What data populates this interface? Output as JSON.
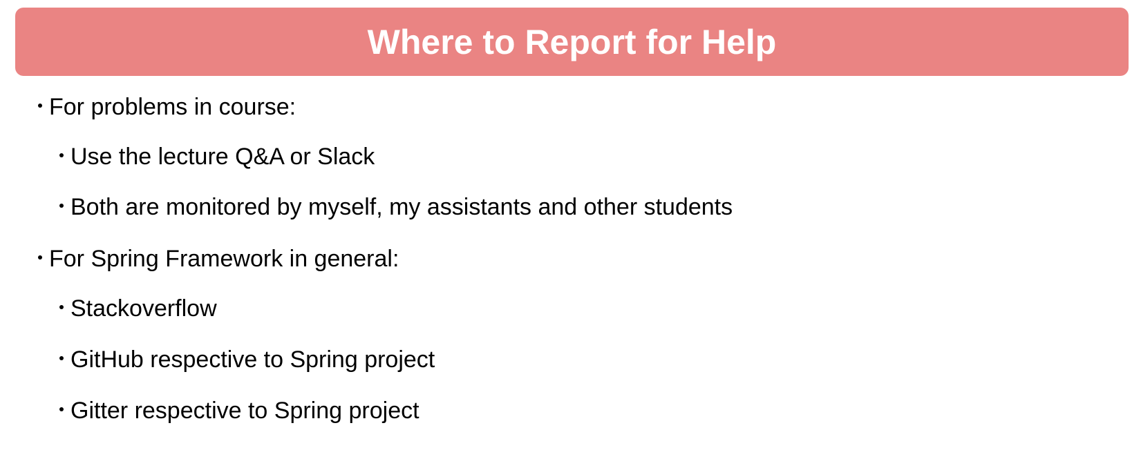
{
  "slide": {
    "title": "Where to Report for Help",
    "banner_color": "#ea8483",
    "bullets": [
      {
        "level": 1,
        "text": "For problems in course:"
      },
      {
        "level": 2,
        "text": "Use the lecture Q&A or Slack"
      },
      {
        "level": 2,
        "text": "Both are monitored by myself, my assistants and other students"
      },
      {
        "level": 1,
        "text": "For Spring Framework in general:"
      },
      {
        "level": 2,
        "text": "Stackoverflow"
      },
      {
        "level": 2,
        "text": "GitHub respective to Spring project"
      },
      {
        "level": 2,
        "text": "Gitter respective to Spring project"
      }
    ]
  }
}
